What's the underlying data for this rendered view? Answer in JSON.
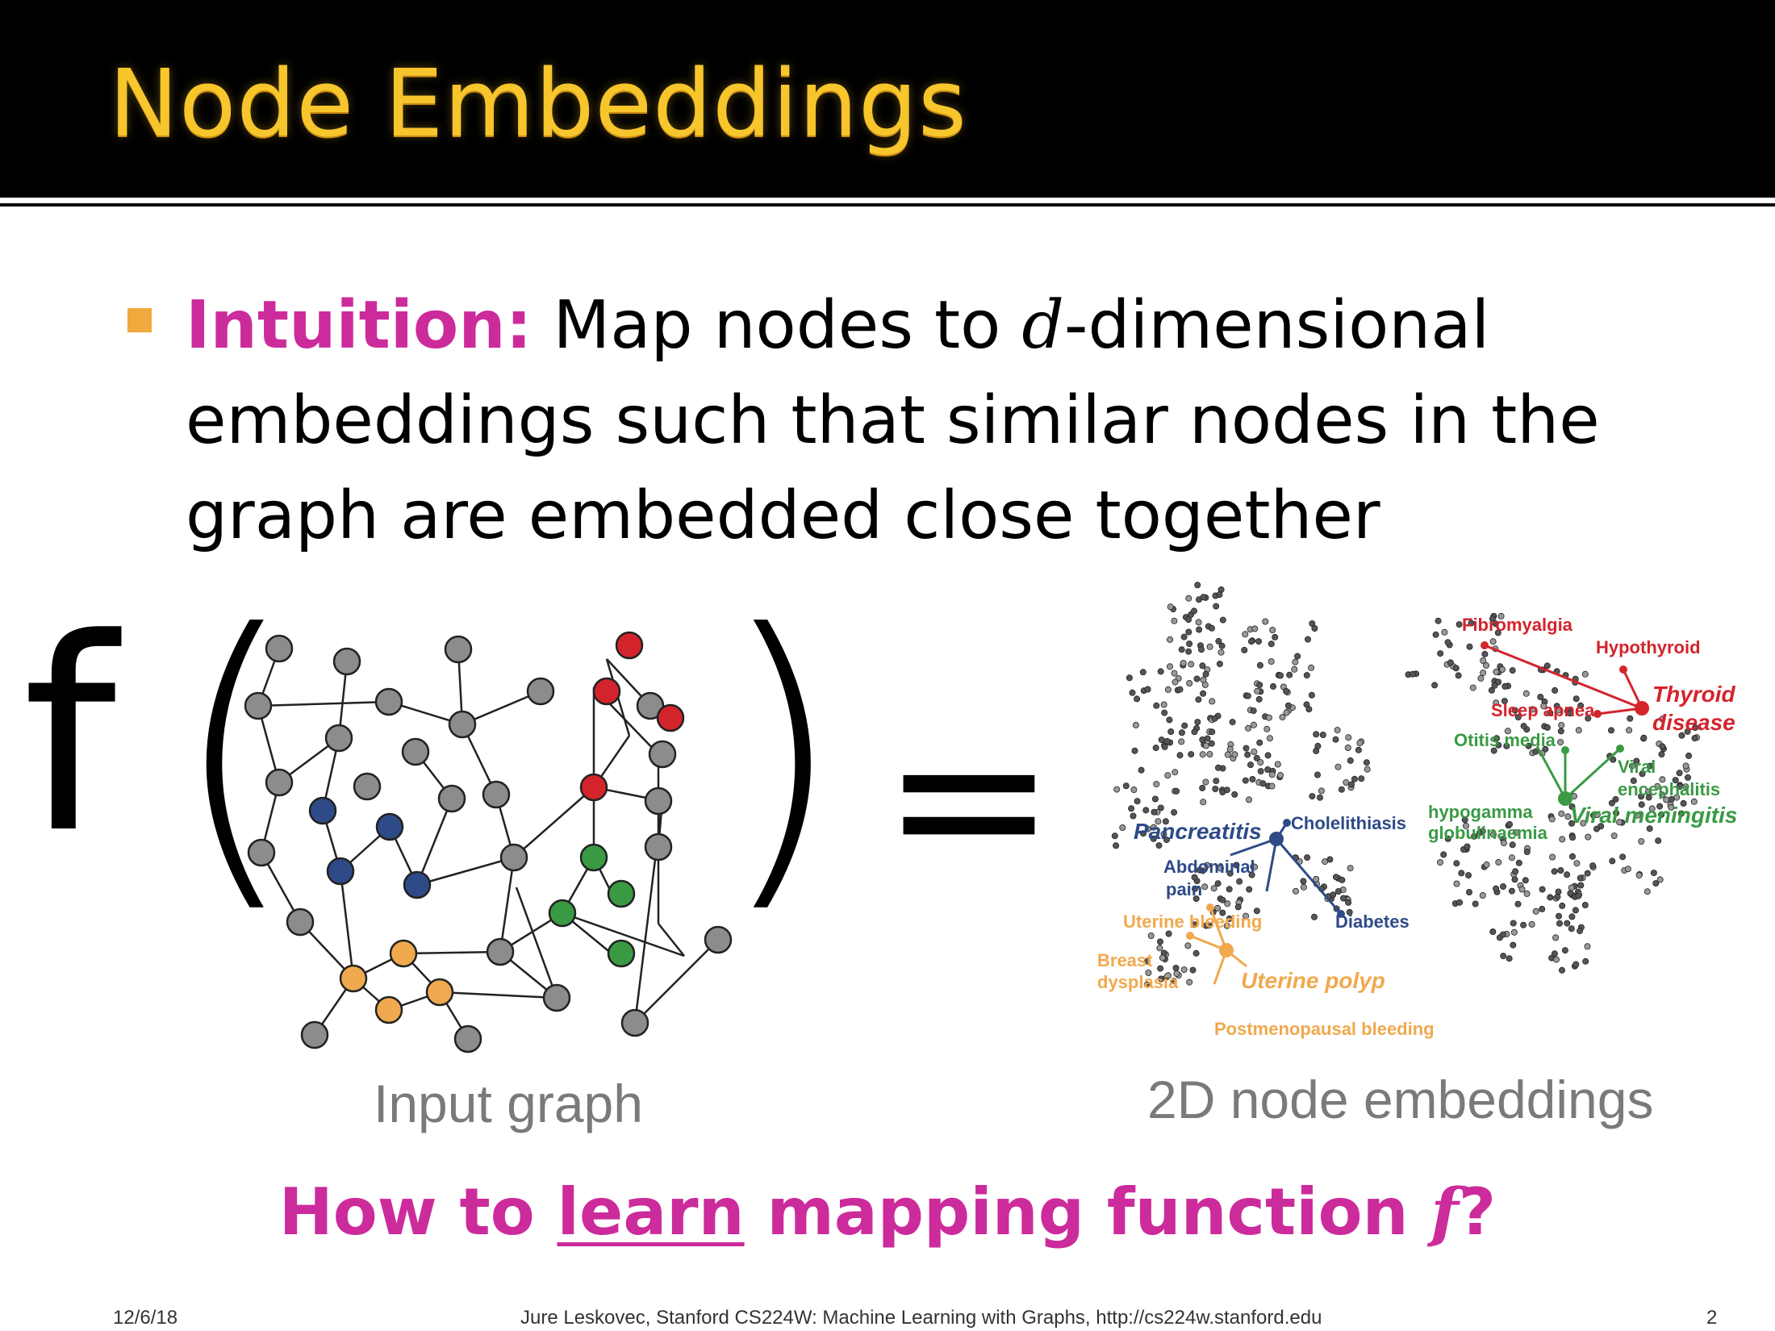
{
  "slide": {
    "title": "Node Embeddings",
    "bullet": {
      "keyword": "Intuition:",
      "text_before_var": " Map nodes to ",
      "var": "d",
      "text_after_var": "-dimensional embeddings such that similar nodes in the graph are embedded close together"
    },
    "formula": {
      "function": "f",
      "open_paren": "(",
      "close_paren": ")",
      "equals": "="
    },
    "captions": {
      "input": "Input graph",
      "output": "2D node embeddings"
    },
    "question": {
      "before": "How to ",
      "underlined": "learn",
      "after": " mapping function ",
      "var": "f",
      "end": "?"
    },
    "footer": {
      "date": "12/6/18",
      "credit": "Jure Leskovec, Stanford CS224W: Machine Learning with Graphs, http://cs224w.stanford.edu",
      "page": "2"
    }
  },
  "colors": {
    "title": "#f7c52c",
    "accent": "#cc2b9b",
    "bullet": "#f0a93c",
    "node_gray": "#8c8c8c",
    "node_blue": "#2e4a87",
    "node_orange": "#f0a94e",
    "node_red": "#d3242c",
    "node_green": "#3a9a44"
  },
  "embedding_labels": {
    "red": [
      "Fibromyalgia",
      "Hypothyroid",
      "Thyroid",
      "disease",
      "Sleep apnea"
    ],
    "green": [
      "Otitis media",
      "Viral",
      "encephalitis",
      "hypogamma",
      "globulinaemia",
      "Viral meningitis"
    ],
    "blue": [
      "Pancreatitis",
      "Cholelithiasis",
      "Abdominal",
      "pain",
      "Diabetes"
    ],
    "orange": [
      "Uterine bleeding",
      "Breast",
      "dysplasia",
      "Uterine polyp",
      "Postmenopausal bleeding"
    ]
  }
}
